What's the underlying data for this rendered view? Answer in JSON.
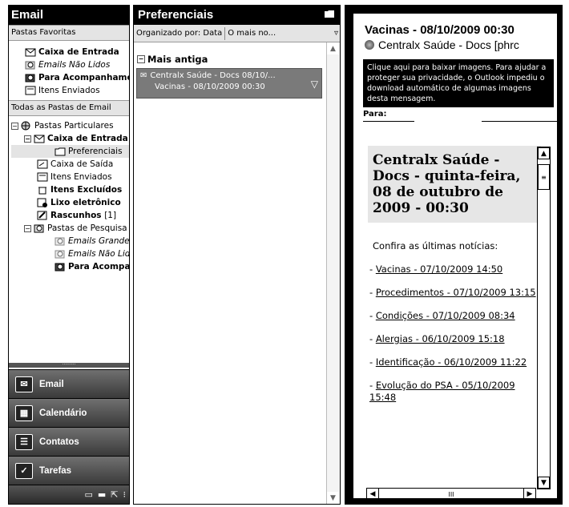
{
  "nav": {
    "title": "Email",
    "favorites_header": "Pastas Favoritas",
    "favorites": [
      {
        "label": "Caixa de Entrada",
        "bold": true,
        "icon": "inbox-icon"
      },
      {
        "label": "Emails Não Lidos",
        "italic": true,
        "icon": "search-folder-icon"
      },
      {
        "label": "Para Acompanhamento",
        "bold": true,
        "icon": "search-folder-icon"
      },
      {
        "label": "Itens Enviados",
        "icon": "sent-icon"
      }
    ],
    "all_header": "Todas as Pastas de Email",
    "tree": [
      {
        "label": "Pastas Particulares",
        "expander": "⊟"
      },
      {
        "label": "Caixa de Entrada",
        "bold": true,
        "expander": "⊟"
      },
      {
        "label": "Preferenciais"
      },
      {
        "label": "Caixa de Saída"
      },
      {
        "label": "Itens Enviados"
      },
      {
        "label": "Itens Excluídos",
        "bold": true
      },
      {
        "label": "Lixo eletrônico",
        "bold": true
      },
      {
        "label": "Rascunhos",
        "bold": true,
        "count": "[1]"
      },
      {
        "label": "Pastas de Pesquisa",
        "expander": "⊟"
      },
      {
        "label": "Emails Grandes",
        "italic": true
      },
      {
        "label": "Emails Não Lidos",
        "italic": true
      },
      {
        "label": "Para Acompanhamento",
        "bold": true
      }
    ],
    "buttons": [
      {
        "label": "Email",
        "icon": "envelope-icon"
      },
      {
        "label": "Calendário",
        "icon": "calendar-icon"
      },
      {
        "label": "Contatos",
        "icon": "contacts-icon"
      },
      {
        "label": "Tarefas",
        "icon": "tasks-icon"
      }
    ]
  },
  "list": {
    "title": "Preferenciais",
    "arranged": "Organizado por: Data",
    "sort": "O mais no...",
    "group": "Mais antiga",
    "message": {
      "from": "Centralx Saúde - Docs",
      "date": "08/10/...",
      "subject": "Vacinas - 08/10/2009 00:30"
    }
  },
  "reading": {
    "subject": "Vacinas - 08/10/2009 00:30",
    "from": "Centralx Saúde - Docs [phrc",
    "infobar": "Clique aqui para baixar imagens. Para ajudar a proteger sua privacidade, o Outlook impediu o download automático de algumas imagens desta mensagem.",
    "to_label": "Para:",
    "card_title": "Centralx Saúde - Docs - quinta-feira, 08 de outubro de 2009 - 00:30",
    "intro": "Confira as últimas notícias:",
    "news": [
      "Vacinas - 07/10/2009 14:50",
      "Procedimentos - 07/10/2009 13:15",
      "Condições - 07/10/2009 08:34",
      "Alergias - 06/10/2009 15:18",
      "Identificação - 06/10/2009 11:22",
      "Evolução do PSA - 05/10/2009 15:48"
    ]
  }
}
